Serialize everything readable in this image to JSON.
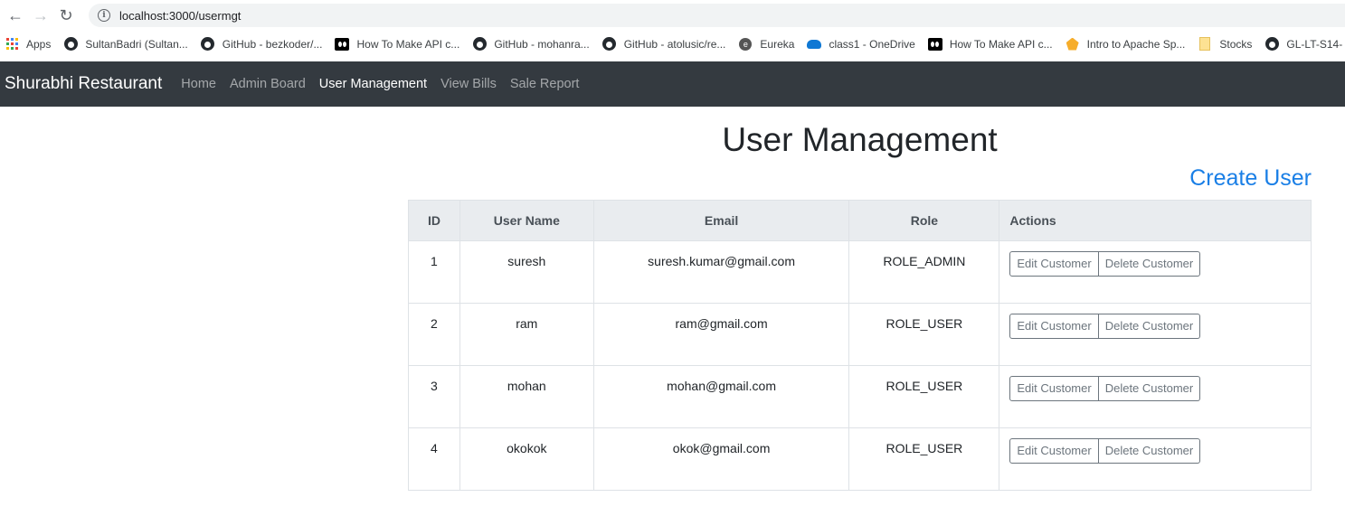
{
  "browser": {
    "url": "localhost:3000/usermgt",
    "bookmarks": [
      {
        "label": "Apps",
        "icon": "apps-grid-icon"
      },
      {
        "label": "SultanBadri (Sultan...",
        "icon": "github-icon"
      },
      {
        "label": "GitHub - bezkoder/...",
        "icon": "github-icon"
      },
      {
        "label": "How To Make API c...",
        "icon": "medium-icon"
      },
      {
        "label": "GitHub - mohanra...",
        "icon": "github-icon"
      },
      {
        "label": "GitHub - atolusic/re...",
        "icon": "github-icon"
      },
      {
        "label": "Eureka",
        "icon": "eureka-icon"
      },
      {
        "label": "class1 - OneDrive",
        "icon": "onedrive-icon"
      },
      {
        "label": "How To Make API c...",
        "icon": "medium-icon"
      },
      {
        "label": "Intro to Apache Sp...",
        "icon": "spark-icon"
      },
      {
        "label": "Stocks",
        "icon": "folder-icon"
      },
      {
        "label": "GL-LT-S14-",
        "icon": "github-icon"
      }
    ]
  },
  "navbar": {
    "brand": "Shurabhi Restaurant",
    "links": [
      "Home",
      "Admin Board",
      "User Management",
      "View Bills",
      "Sale Report"
    ],
    "active": "User Management"
  },
  "main": {
    "title": "User Management",
    "create_user": "Create User",
    "columns": [
      "ID",
      "User Name",
      "Email",
      "Role",
      "Actions"
    ],
    "rows": [
      {
        "id": "1",
        "username": "suresh",
        "email": "suresh.kumar@gmail.com",
        "role": "ROLE_ADMIN"
      },
      {
        "id": "2",
        "username": "ram",
        "email": "ram@gmail.com",
        "role": "ROLE_USER"
      },
      {
        "id": "3",
        "username": "mohan",
        "email": "mohan@gmail.com",
        "role": "ROLE_USER"
      },
      {
        "id": "4",
        "username": "okokok",
        "email": "okok@gmail.com",
        "role": "ROLE_USER"
      }
    ],
    "edit_label": "Edit Customer",
    "delete_label": "Delete Customer"
  },
  "colors": {
    "navbar_bg": "#343a40",
    "link": "#1a7fe6",
    "table_head_bg": "#e9ecef",
    "button_border": "#6c757d"
  }
}
